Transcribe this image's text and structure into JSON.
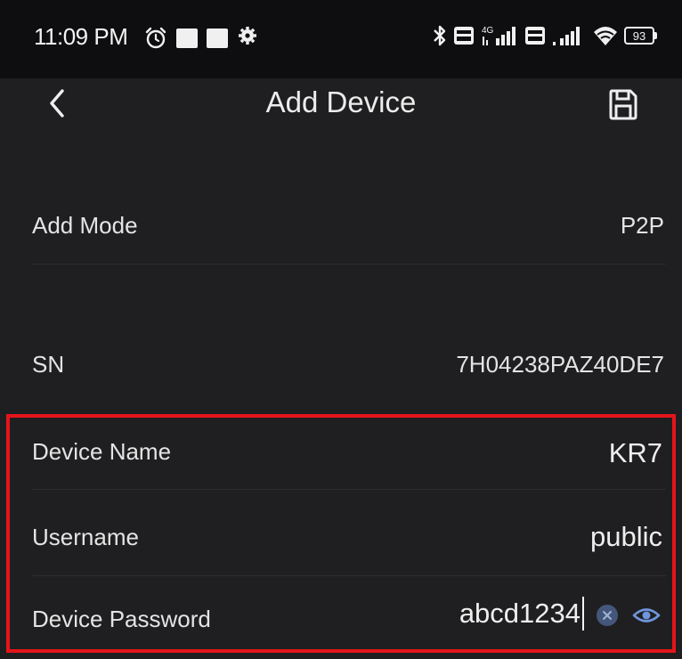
{
  "status_bar": {
    "time": "11:09 PM",
    "battery": "93",
    "icons": [
      "alarm-icon",
      "notification-square-icon",
      "notification-square-icon",
      "settings-gear-icon",
      "bluetooth-icon",
      "volte-icon",
      "4g-signal-icon",
      "volte-icon",
      "signal-icon",
      "wifi-icon",
      "battery-icon"
    ]
  },
  "nav": {
    "title": "Add Device",
    "back_icon": "chevron-left-icon",
    "save_icon": "floppy-disk-icon"
  },
  "fields": {
    "add_mode": {
      "label": "Add Mode",
      "value": "P2P"
    },
    "sn": {
      "label": "SN",
      "value": "7H04238PAZ40DE7"
    },
    "device_name": {
      "label": "Device Name",
      "value": "KR7"
    },
    "username": {
      "label": "Username",
      "value": "public"
    },
    "device_password": {
      "label": "Device Password",
      "value": "abcd1234",
      "clear_icon": "clear-x-icon",
      "reveal_icon": "eye-icon"
    }
  },
  "colors": {
    "background": "#1f1f21",
    "status_bar": "#0e0e10",
    "text": "#e4e4e4",
    "highlight": "#e5141a",
    "accent": "#6f95dc"
  }
}
